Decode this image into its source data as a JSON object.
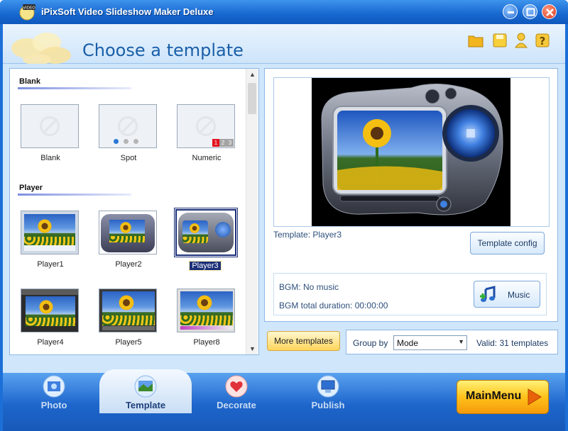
{
  "window": {
    "title": "iPixSoft Video Slideshow Maker Deluxe",
    "icon_badge": "VIDEO"
  },
  "header": {
    "heading": "Choose a template"
  },
  "templates": {
    "sections": [
      {
        "title": "Blank"
      },
      {
        "title": "Player"
      }
    ],
    "blank_items": [
      "Blank",
      "Spot",
      "Numeric"
    ],
    "numeric_marks": [
      "1",
      "2",
      "3"
    ],
    "player_items": [
      "Player1",
      "Player2",
      "Player3",
      "Player4",
      "Player5",
      "Player8"
    ],
    "selected": "Player3"
  },
  "preview": {
    "template_label": "Template:  Player3",
    "config_button": "Template config"
  },
  "bgm": {
    "music_line": "BGM: No music",
    "duration_line": "BGM total duration: 00:00:00",
    "music_button": "Music"
  },
  "toolbar": {
    "more_templates": "More templates",
    "group_by_label": "Group by",
    "group_by_value": "Mode",
    "valid_count": "Valid: 31 templates"
  },
  "nav": {
    "tabs": [
      "Photo",
      "Template",
      "Decorate",
      "Publish"
    ],
    "active": "Template",
    "main_menu": "MainMenu"
  }
}
